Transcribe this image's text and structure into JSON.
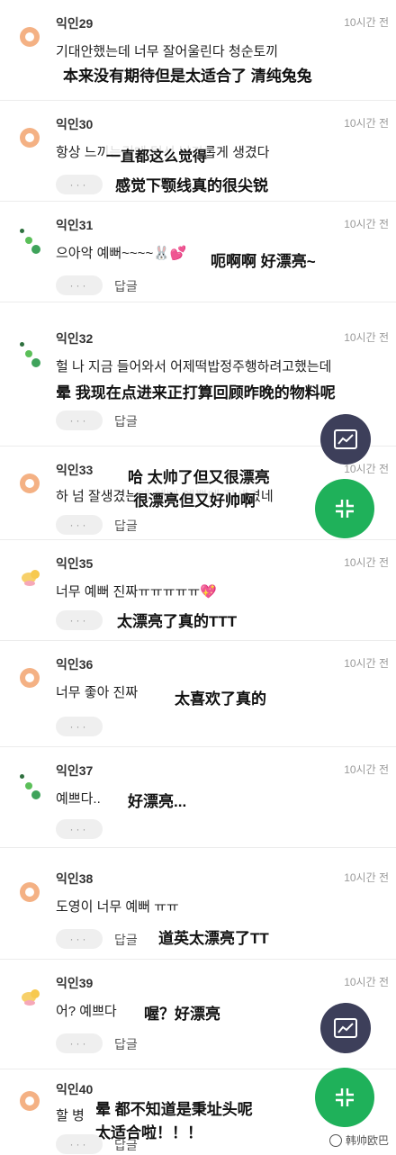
{
  "comments": [
    {
      "user": "익인29",
      "time": "10시간 전",
      "korean": "기대안했는데 너무 잘어울린다 청순토끼",
      "chinese": "本来没有期待但是太适合了 清纯兔兔",
      "avatar": "ring"
    },
    {
      "user": "익인30",
      "time": "10시간 전",
      "korean": "항상 느끼는건데 턱선 날카롭게 생겼다",
      "chinese_a": "一直都这么觉得",
      "chinese": "感觉下颚线真的很尖锐",
      "avatar": "ring",
      "more": "···"
    },
    {
      "user": "익인31",
      "time": "10시간 전",
      "korean": "으아악 예뻐~~~~🐰💕",
      "chinese": "呃啊啊 好漂亮~",
      "avatar": "dots",
      "more": "···",
      "reply": "답글"
    },
    {
      "user": "익인32",
      "time": "10시간 전",
      "korean": "헐 나 지금 들어와서 어제떡밥정주행하려고했는데",
      "chinese": "晕 我现在点进来正打算回顾昨晚的物料呢",
      "avatar": "dots",
      "more": "···",
      "reply": "답글"
    },
    {
      "user": "익인33",
      "time": "10시간 전",
      "korean": "하 넘 잘생겼는데 예뻐 예쁜데 잘생겼네",
      "chinese_a": "哈 太帅了但又很漂亮",
      "chinese": "很漂亮但又好帅啊",
      "avatar": "ring",
      "more": "···",
      "reply": "답글"
    },
    {
      "user": "익인35",
      "time": "10시간 전",
      "korean": "너무 예뻐 진짜ㅠㅠㅠㅠㅠ💖",
      "chinese": "太漂亮了真的TTT",
      "avatar": "bird",
      "more": "···"
    },
    {
      "user": "익인36",
      "time": "10시간 전",
      "korean": "너무 좋아 진짜",
      "chinese": "太喜欢了真的",
      "avatar": "ring",
      "more": "···"
    },
    {
      "user": "익인37",
      "time": "10시간 전",
      "korean": "예쁘다..",
      "chinese": "好漂亮...",
      "avatar": "dots",
      "more": "···"
    },
    {
      "user": "익인38",
      "time": "10시간 전",
      "korean": "도영이 너무 예뻐 ㅠㅠ",
      "chinese": "道英太漂亮了TT",
      "avatar": "ring",
      "more": "···",
      "reply": "답글"
    },
    {
      "user": "익인39",
      "time": "10시간 전",
      "korean": "어? 예쁘다",
      "chinese": "喔？好漂亮",
      "avatar": "bird",
      "more": "···",
      "reply": "답글"
    },
    {
      "user": "익인40",
      "time": "10시간 전",
      "korean": "할 병",
      "chinese": "晕 都不知道是秉址头呢",
      "chinese_b": "太适合啦！！！",
      "avatar": "ring",
      "more": "···",
      "reply": "답글"
    }
  ],
  "watermark": "韩帅欧巴"
}
